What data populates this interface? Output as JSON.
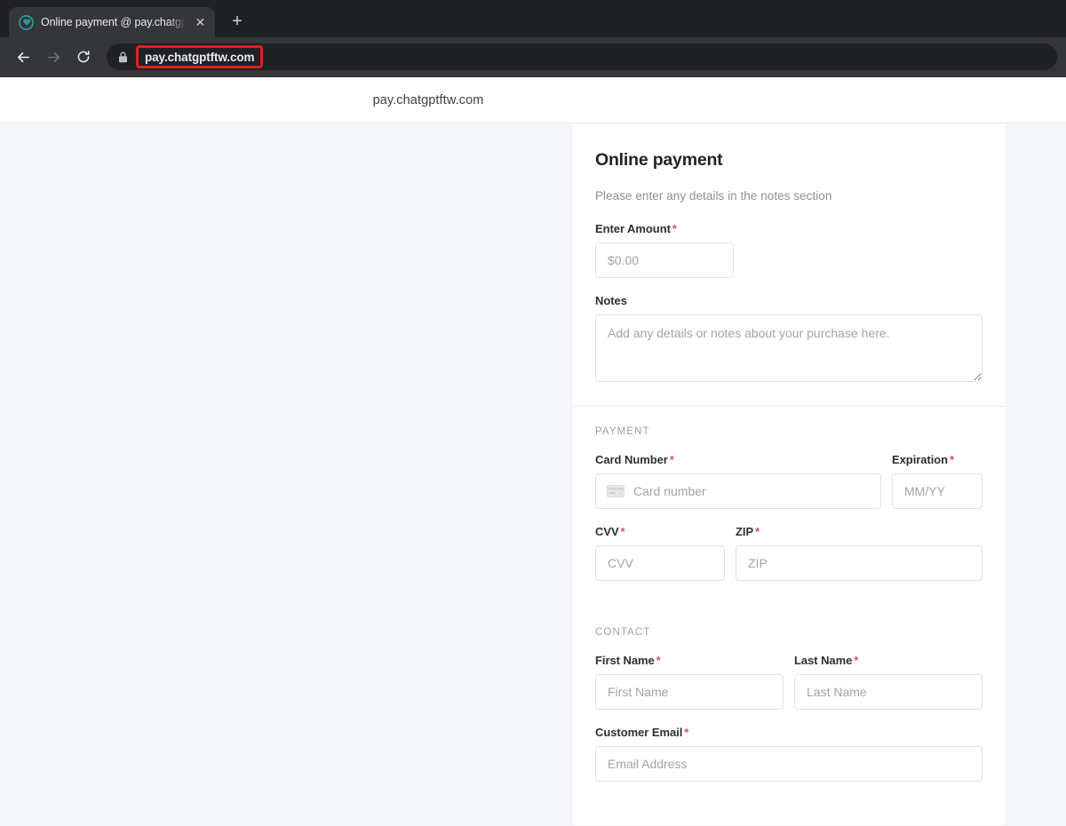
{
  "browser": {
    "tab": {
      "title": "Online payment @ pay.chatgptft",
      "favicon_name": "site-favicon",
      "close_glyph": "✕"
    },
    "new_tab_glyph": "+",
    "nav": {
      "back_label": "Back",
      "forward_label": "Forward",
      "reload_label": "Reload"
    },
    "omnibox": {
      "url": "pay.chatgptftw.com",
      "lock_icon": "lock-icon",
      "highlight_color": "#e02020"
    }
  },
  "page": {
    "header_domain": "pay.chatgptftw.com",
    "form": {
      "title": "Online payment",
      "subtitle": "Please enter any details in the notes section",
      "amount": {
        "label": "Enter Amount",
        "required": "*",
        "placeholder": "$0.00",
        "value": ""
      },
      "notes": {
        "label": "Notes",
        "required": "",
        "placeholder": "Add any details or notes about your purchase here.",
        "value": ""
      },
      "payment_section": {
        "heading": "PAYMENT",
        "card_number": {
          "label": "Card Number",
          "required": "*",
          "placeholder": "Card number",
          "value": "",
          "icon": "credit-card-icon"
        },
        "expiration": {
          "label": "Expiration",
          "required": "*",
          "placeholder": "MM/YY",
          "value": ""
        },
        "cvv": {
          "label": "CVV",
          "required": "*",
          "placeholder": "CVV",
          "value": ""
        },
        "zip": {
          "label": "ZIP",
          "required": "*",
          "placeholder": "ZIP",
          "value": ""
        }
      },
      "contact_section": {
        "heading": "CONTACT",
        "first_name": {
          "label": "First Name",
          "required": "*",
          "placeholder": "First Name",
          "value": ""
        },
        "last_name": {
          "label": "Last Name",
          "required": "*",
          "placeholder": "Last Name",
          "value": ""
        },
        "customer_email": {
          "label": "Customer Email",
          "required": "*",
          "placeholder": "Email Address",
          "value": ""
        }
      }
    }
  },
  "colors": {
    "page_background": "#f4f6fa",
    "card_background": "#ffffff",
    "required_asterisk": "#e05252",
    "chrome_tabstrip": "#202124",
    "chrome_toolbar": "#35363a",
    "favicon_teal": "#2e9a92"
  }
}
